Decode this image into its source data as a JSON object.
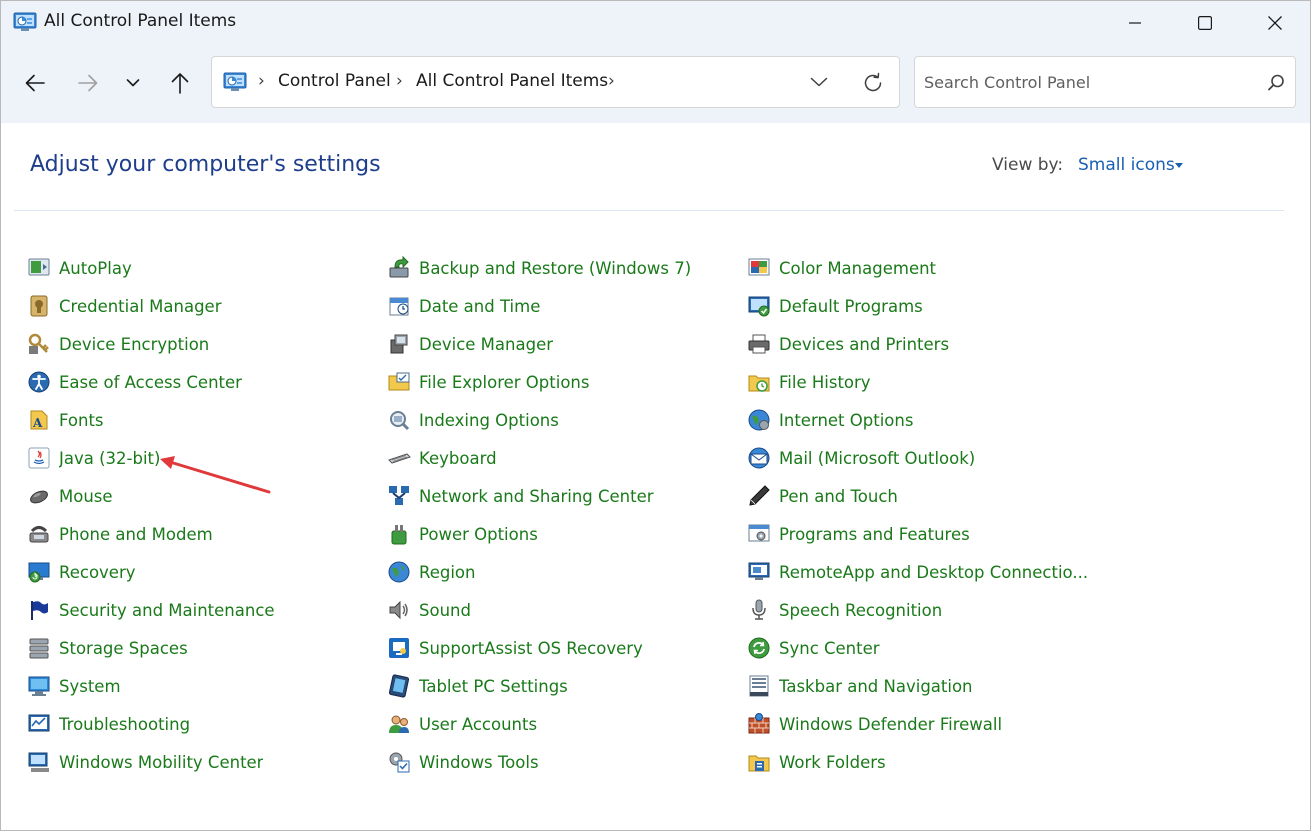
{
  "window": {
    "title": "All Control Panel Items"
  },
  "nav": {
    "breadcrumbs": [
      "Control Panel",
      "All Control Panel Items"
    ],
    "search_placeholder": "Search Control Panel"
  },
  "header": {
    "title": "Adjust your computer's settings",
    "viewby_label": "View by:",
    "viewby_value": "Small icons"
  },
  "columns": [
    [
      {
        "label": "AutoPlay",
        "icon": "autoplay-icon"
      },
      {
        "label": "Credential Manager",
        "icon": "credential-manager-icon"
      },
      {
        "label": "Device Encryption",
        "icon": "device-encryption-icon"
      },
      {
        "label": "Ease of Access Center",
        "icon": "ease-of-access-icon"
      },
      {
        "label": "Fonts",
        "icon": "fonts-icon"
      },
      {
        "label": "Java (32-bit)",
        "icon": "java-icon"
      },
      {
        "label": "Mouse",
        "icon": "mouse-icon"
      },
      {
        "label": "Phone and Modem",
        "icon": "phone-modem-icon"
      },
      {
        "label": "Recovery",
        "icon": "recovery-icon"
      },
      {
        "label": "Security and Maintenance",
        "icon": "flag-icon"
      },
      {
        "label": "Storage Spaces",
        "icon": "storage-spaces-icon"
      },
      {
        "label": "System",
        "icon": "system-icon"
      },
      {
        "label": "Troubleshooting",
        "icon": "troubleshooting-icon"
      },
      {
        "label": "Windows Mobility Center",
        "icon": "mobility-center-icon"
      }
    ],
    [
      {
        "label": "Backup and Restore (Windows 7)",
        "icon": "backup-restore-icon"
      },
      {
        "label": "Date and Time",
        "icon": "date-time-icon"
      },
      {
        "label": "Device Manager",
        "icon": "device-manager-icon"
      },
      {
        "label": "File Explorer Options",
        "icon": "folder-options-icon"
      },
      {
        "label": "Indexing Options",
        "icon": "indexing-icon"
      },
      {
        "label": "Keyboard",
        "icon": "keyboard-icon"
      },
      {
        "label": "Network and Sharing Center",
        "icon": "network-icon"
      },
      {
        "label": "Power Options",
        "icon": "power-icon"
      },
      {
        "label": "Region",
        "icon": "region-globe-icon"
      },
      {
        "label": "Sound",
        "icon": "sound-icon"
      },
      {
        "label": "SupportAssist OS Recovery",
        "icon": "supportassist-icon"
      },
      {
        "label": "Tablet PC Settings",
        "icon": "tablet-icon"
      },
      {
        "label": "User Accounts",
        "icon": "user-accounts-icon"
      },
      {
        "label": "Windows Tools",
        "icon": "windows-tools-icon"
      }
    ],
    [
      {
        "label": "Color Management",
        "icon": "color-management-icon"
      },
      {
        "label": "Default Programs",
        "icon": "default-programs-icon"
      },
      {
        "label": "Devices and Printers",
        "icon": "printer-icon"
      },
      {
        "label": "File History",
        "icon": "file-history-icon"
      },
      {
        "label": "Internet Options",
        "icon": "internet-options-icon"
      },
      {
        "label": "Mail (Microsoft Outlook)",
        "icon": "mail-icon"
      },
      {
        "label": "Pen and Touch",
        "icon": "pen-icon"
      },
      {
        "label": "Programs and Features",
        "icon": "programs-features-icon"
      },
      {
        "label": "RemoteApp and Desktop Connectio...",
        "icon": "remoteapp-icon"
      },
      {
        "label": "Speech Recognition",
        "icon": "microphone-icon"
      },
      {
        "label": "Sync Center",
        "icon": "sync-icon"
      },
      {
        "label": "Taskbar and Navigation",
        "icon": "taskbar-icon"
      },
      {
        "label": "Windows Defender Firewall",
        "icon": "firewall-icon"
      },
      {
        "label": "Work Folders",
        "icon": "work-folders-icon"
      }
    ]
  ],
  "colors": {
    "item_text": "#1a7a1a",
    "title_text": "#1e3e8c",
    "link_blue": "#1a5fb4",
    "chrome_bg": "#eef3f9",
    "annotation_arrow": "#e0393b"
  }
}
